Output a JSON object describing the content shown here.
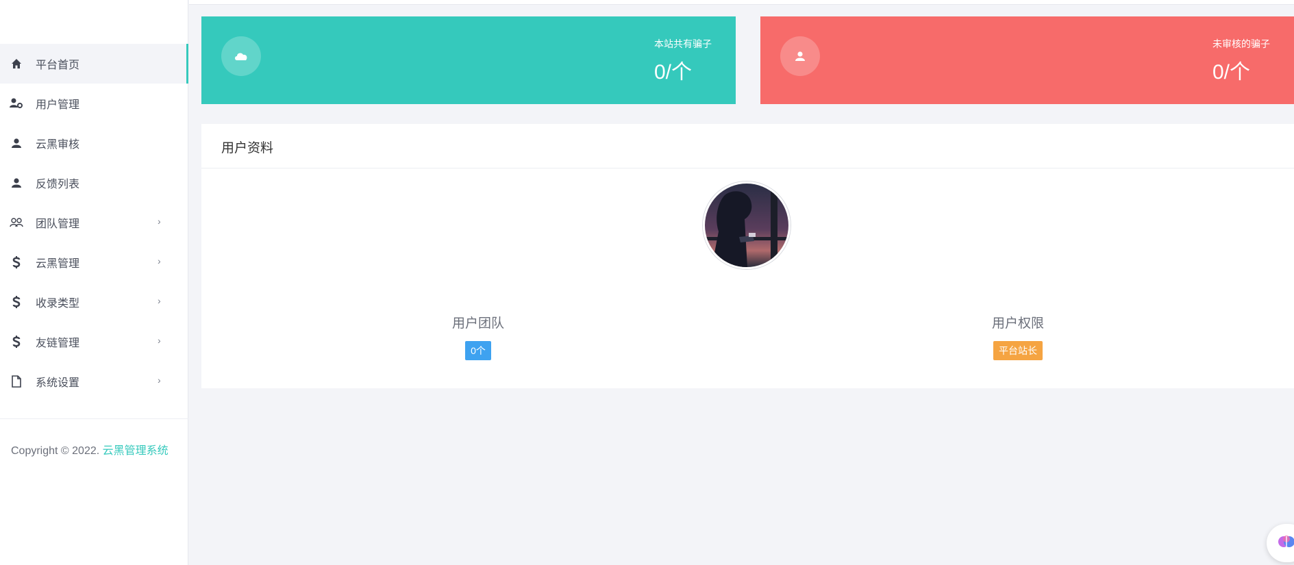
{
  "sidebar": {
    "items": [
      {
        "label": "平台首页",
        "icon": "home-icon",
        "active": true,
        "expandable": false
      },
      {
        "label": "用户管理",
        "icon": "user-cog-icon",
        "active": false,
        "expandable": false
      },
      {
        "label": "云黑审核",
        "icon": "user-icon",
        "active": false,
        "expandable": false
      },
      {
        "label": "反馈列表",
        "icon": "user-icon",
        "active": false,
        "expandable": false
      },
      {
        "label": "团队管理",
        "icon": "users-icon",
        "active": false,
        "expandable": true
      },
      {
        "label": "云黑管理",
        "icon": "dollar-icon",
        "active": false,
        "expandable": true
      },
      {
        "label": "收录类型",
        "icon": "dollar-icon",
        "active": false,
        "expandable": true
      },
      {
        "label": "友链管理",
        "icon": "dollar-icon",
        "active": false,
        "expandable": true
      },
      {
        "label": "系统设置",
        "icon": "file-icon",
        "active": false,
        "expandable": true
      }
    ],
    "chevron": "›",
    "copyright_prefix": "Copyright © 2022.",
    "copyright_link": "云黑管理系统"
  },
  "cards": {
    "scammers": {
      "label": "本站共有骗子",
      "value": "0/个",
      "icon": "cloud-icon",
      "color": "#35c9bc"
    },
    "unreviewed": {
      "label": "未审核的骗子",
      "value": "0/个",
      "icon": "user-icon",
      "color": "#f76b6a"
    }
  },
  "profile": {
    "title": "用户资料",
    "team_label": "用户团队",
    "team_badge": "0个",
    "permission_label": "用户权限",
    "permission_badge": "平台站长"
  },
  "colors": {
    "accent": "#35c9bc",
    "danger": "#f76b6a",
    "badge_blue": "#3ea2f0",
    "badge_orange": "#f5a442"
  }
}
